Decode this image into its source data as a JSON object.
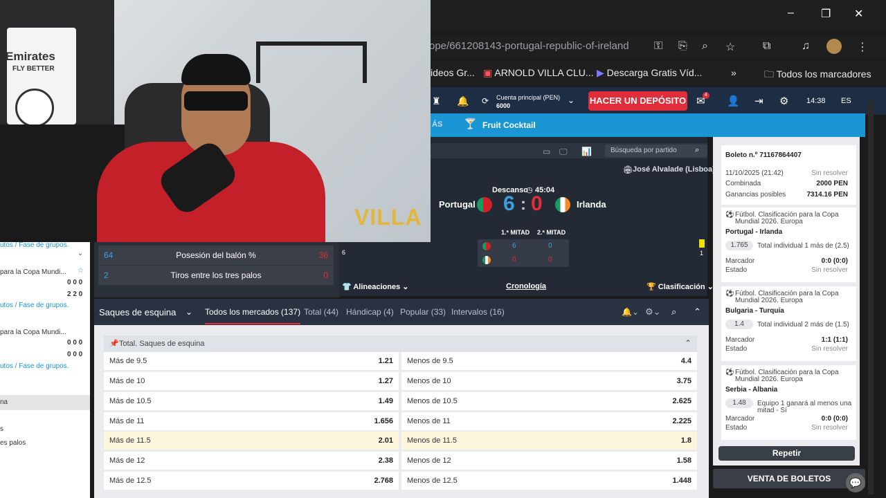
{
  "browser": {
    "url": "ope/661208143-portugal-republic-of-ireland",
    "bookmarks": [
      "ideos Gr...",
      "ARNOLD VILLA CLU...",
      "Descarga Gratis Víd...",
      "Todos los marcadores"
    ],
    "window_controls": [
      "–",
      "❐",
      "✕"
    ]
  },
  "header": {
    "account_label": "Cuenta principal",
    "account_currency": "(PEN)",
    "account_balance": "6000",
    "deposit_label": "HACER UN DEPÓSITO",
    "time": "14:38",
    "language": "ES",
    "notification_count": "4"
  },
  "subnav": {
    "mas": "ÁS",
    "fruit": "Fruit Cocktail"
  },
  "toolbar": {
    "search_placeholder": "Búsqueda por partido"
  },
  "match": {
    "stadium": "José Alvalade (Lisboa)",
    "status": "Descanso",
    "clock": "45:04",
    "home": "Portugal",
    "away": "Irlanda",
    "home_score": "6",
    "away_score": "0",
    "half1": "1.ª MITAD",
    "half2": "2.ª MITAD",
    "h1_home": "6",
    "h2_home": "0",
    "h1_away": "0",
    "h2_away": "0",
    "left_marker": "6",
    "right_marker": "1",
    "lineups": "Alineaciones",
    "chronology": "Cronología",
    "classification": "Clasificación"
  },
  "stats": [
    {
      "home": "64",
      "label": "Posesión del balón %",
      "away": "36"
    },
    {
      "home": "2",
      "label": "Tiros entre los tres palos",
      "away": "0"
    }
  ],
  "left_panel": {
    "rows": [
      "utos / Fase de grupos.",
      "para la Copa Mundi...",
      "0 0 0",
      "2 2 0",
      "utos / Fase de grupos.",
      "para la Copa Mundi...",
      "0 0 0",
      "0 0 0",
      "utos / Fase de grupos.",
      "na",
      "s",
      "es palos"
    ]
  },
  "markets": {
    "category": "Saques de esquina",
    "tabs": [
      "Todos los mercados (137)",
      "Total (44)",
      "Hándicap (4)",
      "Popular (33)",
      "Intervalos (16)"
    ],
    "group_title": "Total. Saques de esquina",
    "rows": [
      {
        "over": "Más de 9.5",
        "over_odd": "1.21",
        "under": "Menos de 9.5",
        "under_odd": "4.4"
      },
      {
        "over": "Más de 10",
        "over_odd": "1.27",
        "under": "Menos de 10",
        "under_odd": "3.75"
      },
      {
        "over": "Más de 10.5",
        "over_odd": "1.49",
        "under": "Menos de 10.5",
        "under_odd": "2.625"
      },
      {
        "over": "Más de 11",
        "over_odd": "1.656",
        "under": "Menos de 11",
        "under_odd": "2.225"
      },
      {
        "over": "Más de 11.5",
        "over_odd": "2.01",
        "under": "Menos de 11.5",
        "under_odd": "1.8"
      },
      {
        "over": "Más de 12",
        "over_odd": "2.38",
        "under": "Menos de 12",
        "under_odd": "1.58"
      },
      {
        "over": "Más de 12.5",
        "over_odd": "2.768",
        "under": "Menos de 12.5",
        "under_odd": "1.448"
      }
    ]
  },
  "slip": {
    "ticket": "Boleto n.º 71167864407",
    "date": "11/10/2025 (21:42)",
    "status": "Sin resolver",
    "type": "Combinada",
    "stake": "2000 PEN",
    "winnings_label": "Ganancias posibles",
    "winnings": "7314.16 PEN",
    "bets": [
      {
        "comp1": "Fútbol. Clasificación para la Copa",
        "comp2": "Mundial 2026. Europa",
        "match": "Portugal - Irlanda",
        "odd": "1.765",
        "pick": "Total individual 1 más de (2.5)",
        "pick2": "",
        "score_label": "Marcador",
        "score": "0:0 (0:0)",
        "state_label": "Estado",
        "state": "Sin resolver"
      },
      {
        "comp1": "Fútbol. Clasificación para la Copa",
        "comp2": "Mundial 2026. Europa",
        "match": "Bulgaria - Turquía",
        "odd": "1.4",
        "pick": "Total individual 2 más de (1.5)",
        "pick2": "",
        "score_label": "Marcador",
        "score": "1:1 (1:1)",
        "state_label": "Estado",
        "state": "Sin resolver"
      },
      {
        "comp1": "Fútbol. Clasificación para la Copa",
        "comp2": "Mundial 2026. Europa",
        "match": "Serbia - Albania",
        "odd": "1.48",
        "pick": "Equipo 1 ganará al menos una",
        "pick2": "mitad - Sí",
        "score_label": "Marcador",
        "score": "0:0 (0:0)",
        "state_label": "Estado",
        "state": "Sin resolver"
      }
    ],
    "repeat": "Repetir",
    "venta": "VENTA DE BOLETOS"
  },
  "webcam": {
    "shirt_text": "Emirates",
    "shirt_text2": "FLY BETTER",
    "watermark": "VILLA"
  },
  "colors": {
    "deposit": "#e12d39",
    "subnav": "#1a96d4",
    "header": "#1d2d44",
    "portugal_red": "#d42027",
    "ireland_green": "#169b62"
  }
}
